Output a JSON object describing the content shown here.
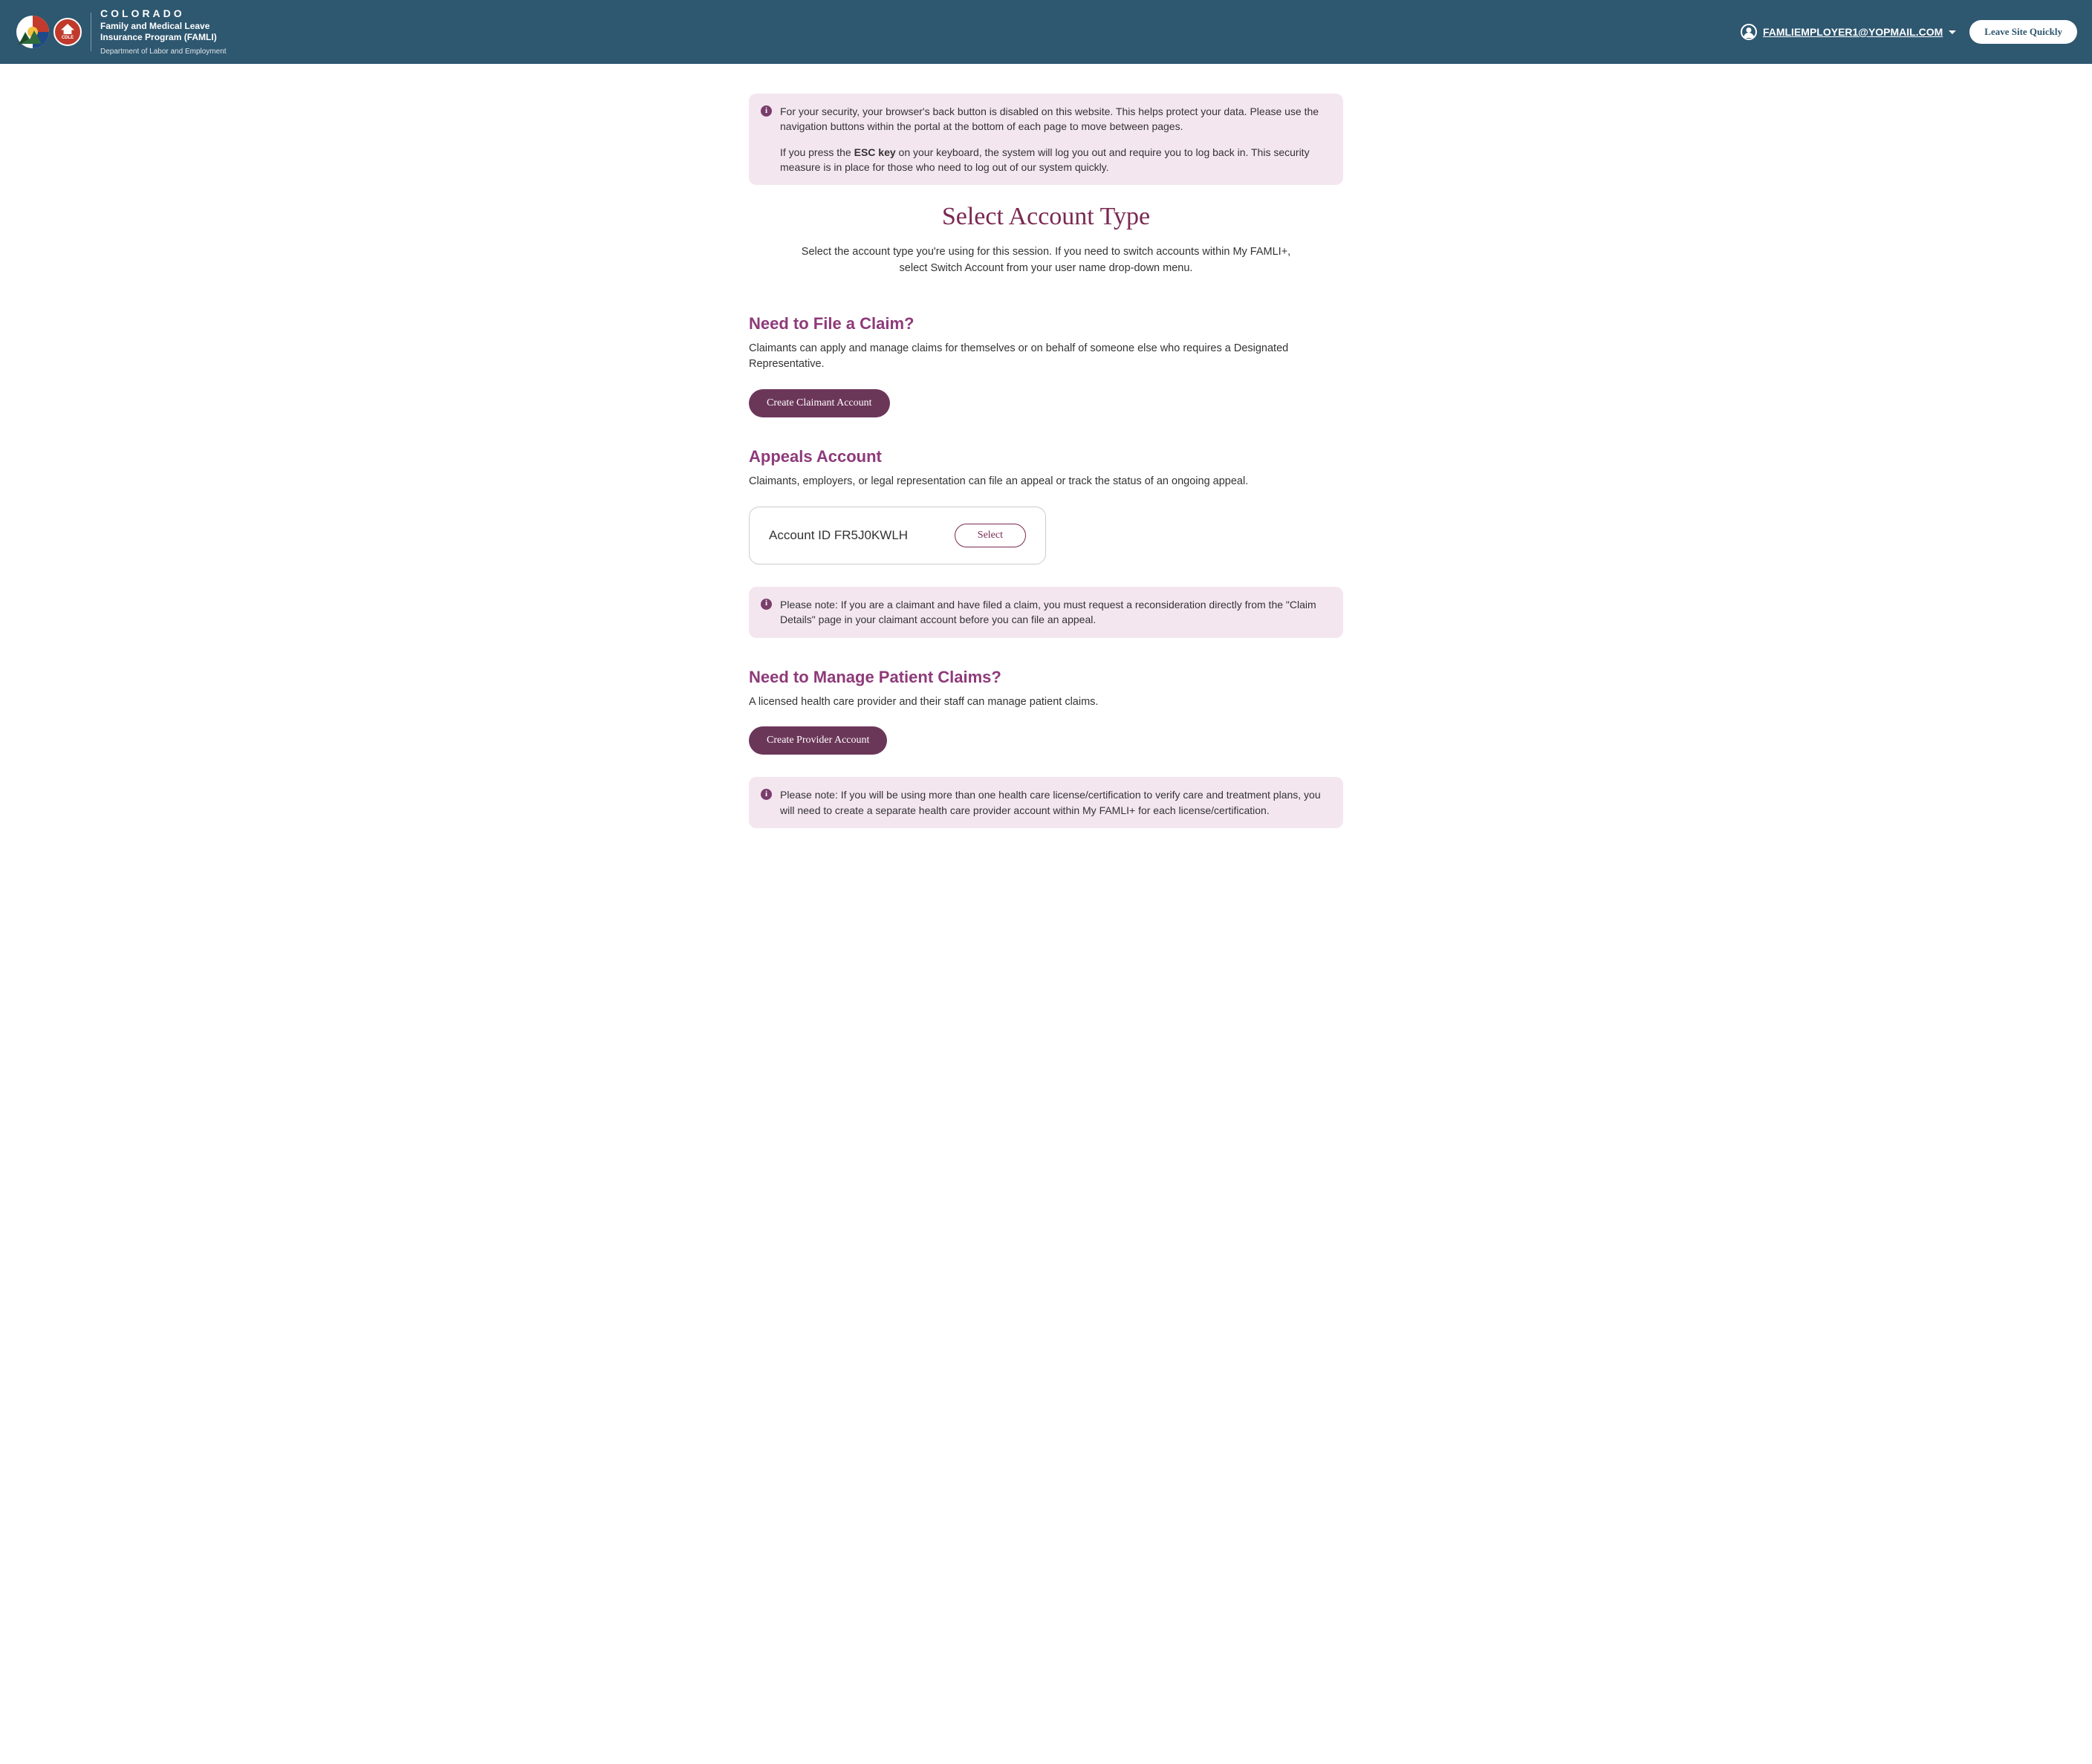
{
  "header": {
    "brand_main": "COLORADO",
    "brand_sub_line1": "Family and Medical Leave",
    "brand_sub_line2": "Insurance Program (FAMLI)",
    "brand_dept": "Department of Labor and Employment",
    "cdle_label": "CDLE",
    "user_email": "FAMLIEMPLOYER1@YOPMAIL.COM",
    "leave_button": "Leave Site Quickly"
  },
  "security_alert": {
    "p1": "For your security, your browser's back button is disabled on this website. This helps protect your data. Please use the navigation buttons within the portal at the bottom of each page to move between pages.",
    "p2_before": "If you press the ",
    "p2_bold": "ESC key",
    "p2_after": " on your keyboard, the system will log you out and require you to log back in. This security measure is in place for those who need to log out of our system quickly."
  },
  "page": {
    "title": "Select Account Type",
    "subtitle": "Select the account type you're using for this session. If you need to switch accounts within My FAMLI+, select Switch Account from your user name drop-down menu."
  },
  "claim_section": {
    "title": "Need to File a Claim?",
    "text": "Claimants can apply and manage claims for themselves or on behalf of someone else who requires a Designated Representative.",
    "button": "Create Claimant Account"
  },
  "appeals_section": {
    "title": "Appeals Account",
    "text": "Claimants, employers, or legal representation can file an appeal or track the status of an ongoing appeal.",
    "account_id": "Account ID FR5J0KWLH",
    "select_button": "Select",
    "note": "Please note: If you are a claimant and have filed a claim, you must request a reconsideration directly from the \"Claim Details\" page in your claimant account before you can file an appeal."
  },
  "provider_section": {
    "title": "Need to Manage Patient Claims?",
    "text": "A licensed health care provider and their staff can manage patient claims.",
    "button": "Create Provider Account",
    "note": "Please note: If you will be using more than one health care license/certification to verify care and treatment plans, you will need to create a separate health care provider account within My FAMLI+ for each license/certification."
  }
}
